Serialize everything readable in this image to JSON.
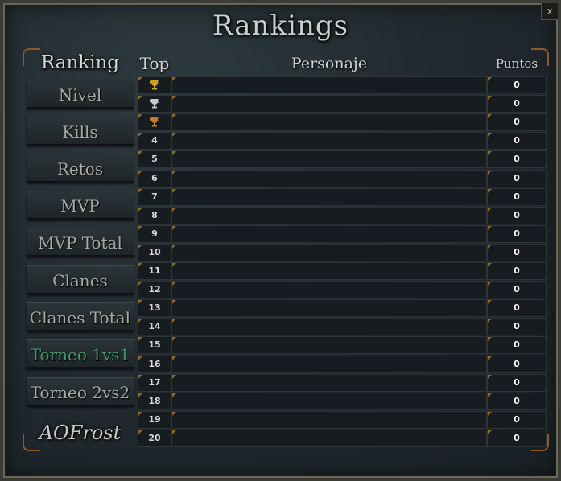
{
  "window": {
    "title": "Rankings",
    "close_label": "x"
  },
  "sidebar": {
    "header": "Ranking",
    "items": [
      {
        "label": "Nivel"
      },
      {
        "label": "Kills"
      },
      {
        "label": "Retos"
      },
      {
        "label": "MVP"
      },
      {
        "label": "MVP Total"
      },
      {
        "label": "Clanes"
      },
      {
        "label": "Clanes Total"
      },
      {
        "label": "Torneo 1vs1"
      },
      {
        "label": "Torneo 2vs2"
      }
    ],
    "active_item": "Torneo 1vs1",
    "brand": "AOFrost"
  },
  "table": {
    "headers": {
      "top": "Top",
      "name": "Personaje",
      "points": "Puntos"
    },
    "rows": [
      {
        "rank": "",
        "icon": "gold-trophy-icon",
        "name": "",
        "points": "0"
      },
      {
        "rank": "",
        "icon": "silver-trophy-icon",
        "name": "",
        "points": "0"
      },
      {
        "rank": "",
        "icon": "bronze-trophy-icon",
        "name": "",
        "points": "0"
      },
      {
        "rank": "4",
        "name": "",
        "points": "0"
      },
      {
        "rank": "5",
        "name": "",
        "points": "0"
      },
      {
        "rank": "6",
        "name": "",
        "points": "0"
      },
      {
        "rank": "7",
        "name": "",
        "points": "0"
      },
      {
        "rank": "8",
        "name": "",
        "points": "0"
      },
      {
        "rank": "9",
        "name": "",
        "points": "0"
      },
      {
        "rank": "10",
        "name": "",
        "points": "0"
      },
      {
        "rank": "11",
        "name": "",
        "points": "0"
      },
      {
        "rank": "12",
        "name": "",
        "points": "0"
      },
      {
        "rank": "13",
        "name": "",
        "points": "0"
      },
      {
        "rank": "14",
        "name": "",
        "points": "0"
      },
      {
        "rank": "15",
        "name": "",
        "points": "0"
      },
      {
        "rank": "16",
        "name": "",
        "points": "0"
      },
      {
        "rank": "17",
        "name": "",
        "points": "0"
      },
      {
        "rank": "18",
        "name": "",
        "points": "0"
      },
      {
        "rank": "19",
        "name": "",
        "points": "0"
      },
      {
        "rank": "20",
        "name": "",
        "points": "0"
      }
    ]
  },
  "colors": {
    "active_item": "#3f9a6a",
    "trophy_gold": "#d4a017",
    "trophy_silver": "#c8c8c8",
    "trophy_bronze": "#c87a2a"
  }
}
